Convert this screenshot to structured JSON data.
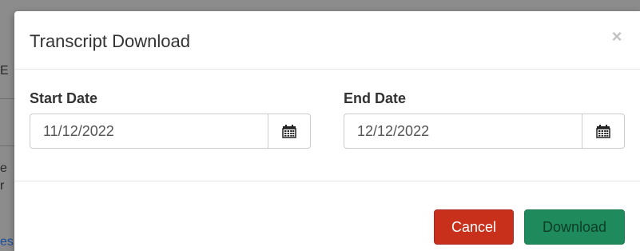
{
  "background": {
    "fragments": [
      "E",
      "e",
      "r",
      "es"
    ]
  },
  "modal": {
    "title": "Transcript Download",
    "close_glyph": "×",
    "start_date": {
      "label": "Start Date",
      "value": "11/12/2022",
      "icon": "calendar-icon"
    },
    "end_date": {
      "label": "End Date",
      "value": "12/12/2022",
      "icon": "calendar-icon"
    },
    "buttons": {
      "cancel": "Cancel",
      "download": "Download"
    }
  },
  "colors": {
    "cancel_button": "#c9301c",
    "download_button": "#1f8a5b",
    "backdrop": "#8c8c8c"
  }
}
